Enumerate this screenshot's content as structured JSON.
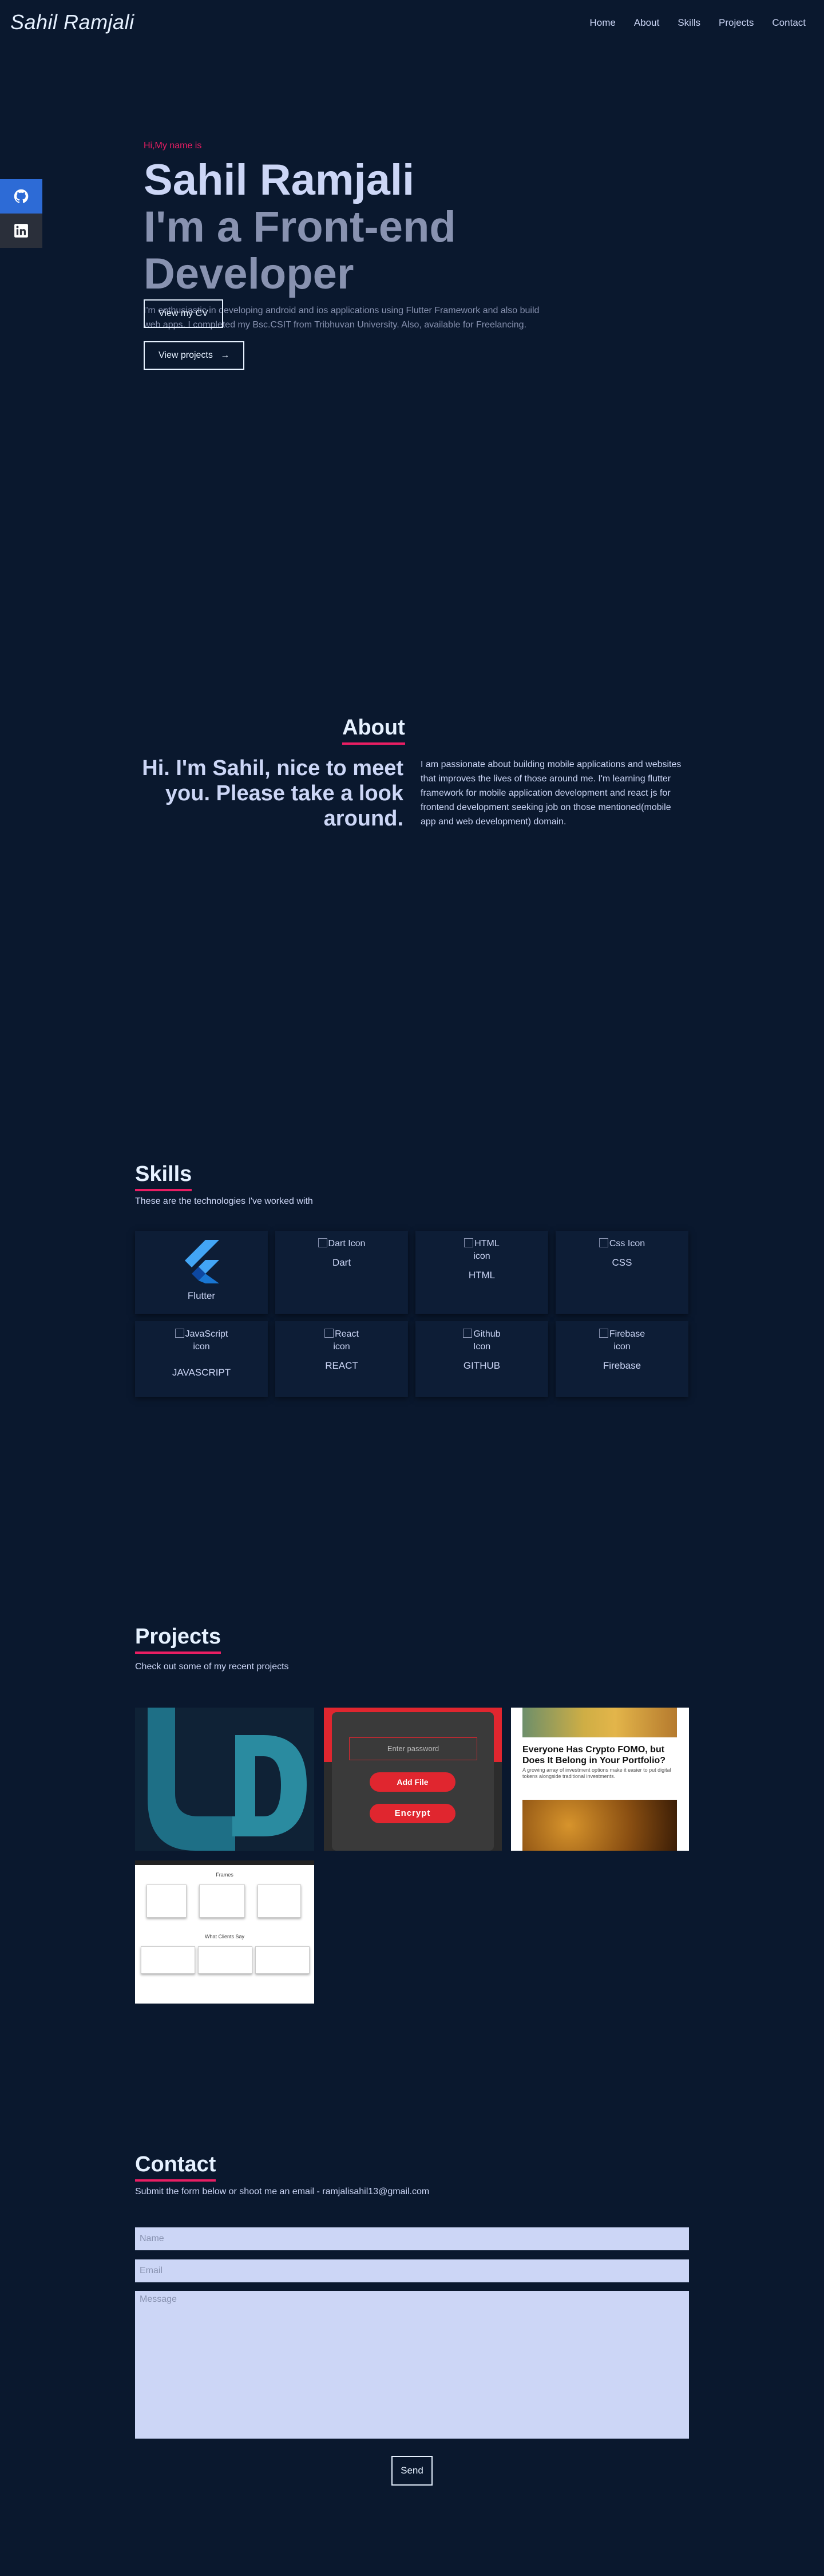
{
  "nav": {
    "logo": "Sahil Ramjali",
    "links": [
      "Home",
      "About",
      "Skills",
      "Projects",
      "Contact"
    ]
  },
  "social": {
    "items": [
      "github-icon",
      "linkedin-icon"
    ]
  },
  "hero": {
    "intro": "Hi,My name is",
    "name": "Sahil Ramjali",
    "role": "I'm a Front-end Developer",
    "description": "I'm enthusiastic in developing android and ios applications using Flutter Framework and also build web apps. I completed my Bsc.CSIT from Tribhuvan University. Also, available for Freelancing.",
    "cv_button": "View my CV",
    "projects_button": "View projects",
    "projects_arrow": "→"
  },
  "about": {
    "title": "About",
    "greeting": "Hi. I'm Sahil, nice to meet you. Please take a look around.",
    "text": "I am passionate about building mobile applications and websites that improves the lives of those around me. I'm learning flutter framework for mobile application development and react js for frontend development seeking job on those mentioned(mobile app and web development) domain."
  },
  "skills": {
    "title": "Skills",
    "subtitle": "These are the technologies I've worked with",
    "items": [
      {
        "alt": "",
        "label": "Flutter"
      },
      {
        "alt": "Dart Icon",
        "label": "Dart"
      },
      {
        "alt": "HTML icon",
        "label": "HTML"
      },
      {
        "alt": "Css Icon",
        "label": "CSS"
      },
      {
        "alt": "JavaScript icon",
        "label": "JAVASCRIPT"
      },
      {
        "alt": "React icon",
        "label": "REACT"
      },
      {
        "alt": "Github Icon",
        "label": "GITHUB"
      },
      {
        "alt": "Firebase icon",
        "label": "Firebase"
      }
    ]
  },
  "projects": {
    "title": "Projects",
    "subtitle": "Check out some of my recent projects",
    "p2": {
      "placeholder": "Enter password",
      "add_file": "Add File",
      "encrypt": "Encrypt"
    },
    "p3": {
      "headline": "Everyone Has Crypto FOMO, but Does It Belong in Your Portfolio?",
      "body": "A growing array of investment options make it easier to put digital tokens alongside traditional investments."
    },
    "p4": {
      "heading1": "Frames",
      "heading2": "What Clients Say"
    }
  },
  "contact": {
    "title": "Contact",
    "subtitle": "Submit the form below or shoot me an email - ramjalisahil13@gmail.com",
    "name_placeholder": "Name",
    "email_placeholder": "Email",
    "message_placeholder": "Message",
    "send": "Send"
  },
  "colors": {
    "background": "#0a182e",
    "accent": "#e91e63",
    "text": "#ccd6f6",
    "muted": "#8892b0"
  }
}
